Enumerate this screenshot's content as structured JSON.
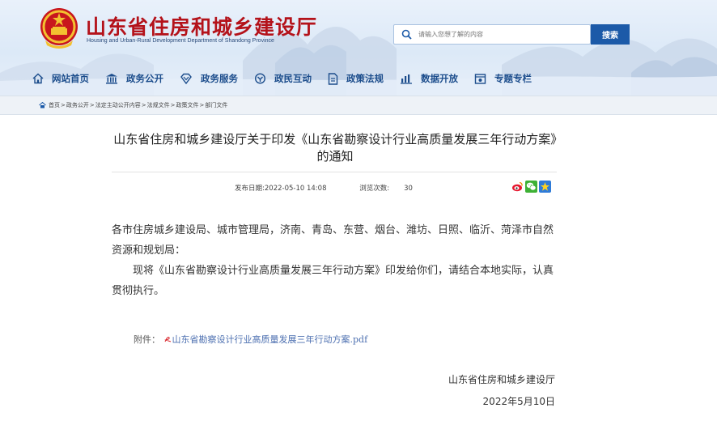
{
  "header": {
    "title": "山东省住房和城乡建设厅",
    "subtitle": "Housing and Urban-Rural Development Department of Shandong Province",
    "logo_icon": "national-emblem-icon"
  },
  "search": {
    "placeholder": "请输入您想了解的内容",
    "button_label": "搜索"
  },
  "nav": {
    "items": [
      {
        "label": "网站首页",
        "icon": "home-icon"
      },
      {
        "label": "政务公开",
        "icon": "government-building-icon"
      },
      {
        "label": "政务服务",
        "icon": "diamond-service-icon"
      },
      {
        "label": "政民互动",
        "icon": "interaction-icon"
      },
      {
        "label": "政策法规",
        "icon": "document-icon"
      },
      {
        "label": "数据开放",
        "icon": "bar-chart-icon"
      },
      {
        "label": "专题专栏",
        "icon": "topic-icon"
      }
    ]
  },
  "breadcrumb": {
    "items": [
      "首页",
      "政务公开",
      "法定主动公开内容",
      "法规文件",
      "政策文件",
      "部门文件"
    ],
    "separator": ">"
  },
  "article": {
    "title": "山东省住房和城乡建设厅关于印发《山东省勘察设计行业高质量发展三年行动方案》的通知",
    "publish_label": "发布日期:",
    "publish_date": "2022-05-10 14:08",
    "views_label": "浏览次数:",
    "views": "30",
    "share_icons": [
      "weibo-icon",
      "wechat-icon",
      "favorite-star-icon"
    ],
    "addressee": "各市住房城乡建设局、城市管理局，济南、青岛、东营、烟台、潍坊、日照、临沂、菏泽市自然资源和规划局：",
    "body": "现将《山东省勘察设计行业高质量发展三年行动方案》印发给你们，请结合本地实际，认真贯彻执行。",
    "attachment_label": "附件：",
    "attachment_file": "山东省勘察设计行业高质量发展三年行动方案.pdf",
    "signature_org": "山东省住房和城乡建设厅",
    "signature_date": "2022年5月10日"
  },
  "colors": {
    "title_red": "#b4121a",
    "nav_blue": "#1c4d8c",
    "search_button": "#1c5aa8"
  }
}
